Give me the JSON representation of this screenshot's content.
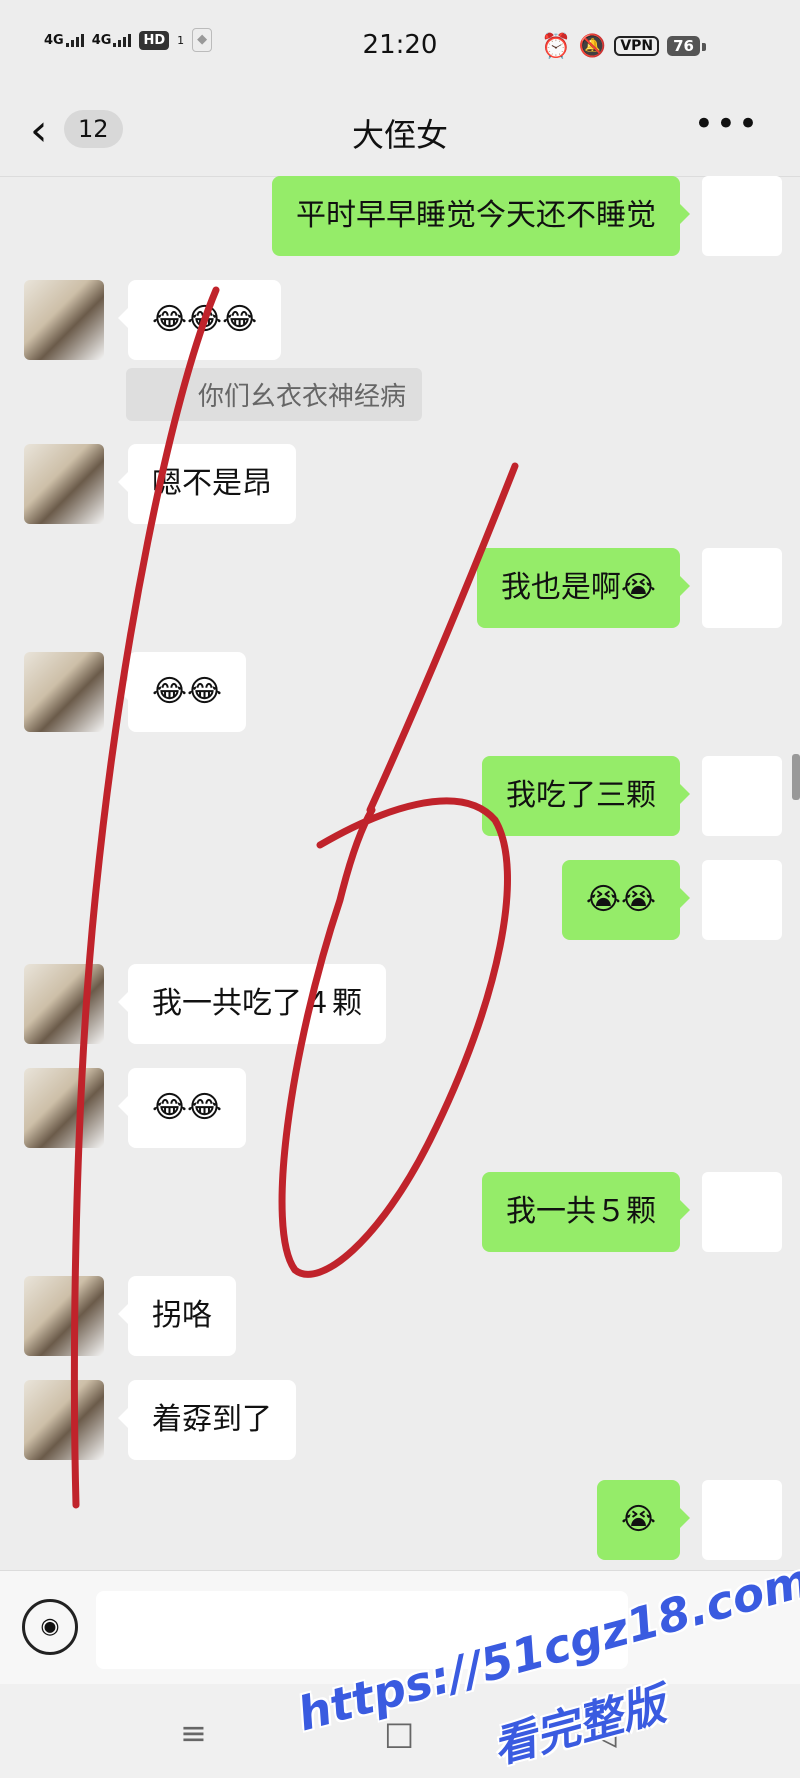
{
  "status": {
    "net1": "4G",
    "net2": "4G",
    "hd": "HD",
    "sim": "1",
    "time": "21:20",
    "vpn": "VPN",
    "battery": "76"
  },
  "header": {
    "back_icon": "chevron-left-icon",
    "unread_count": "12",
    "title": "大侄女",
    "more_icon": "ellipsis-icon"
  },
  "messages": [
    {
      "side": "self",
      "text": "平时早早睡觉今天还不睡觉"
    },
    {
      "side": "other",
      "text": "😂😂😂"
    },
    {
      "side": "other",
      "text": "嗯不是昂"
    },
    {
      "side": "self",
      "text": "我也是啊😭"
    },
    {
      "side": "other",
      "text": "😂😂"
    },
    {
      "side": "self",
      "text": "我吃了三颗"
    },
    {
      "side": "self",
      "text": "😭😭"
    },
    {
      "side": "other",
      "text": "我一共吃了４颗"
    },
    {
      "side": "other",
      "text": "😂😂"
    },
    {
      "side": "self",
      "text": "我一共５颗"
    },
    {
      "side": "other",
      "text": "拐咯"
    },
    {
      "side": "other",
      "text": "着孬到了"
    },
    {
      "side": "self",
      "text": "😭"
    }
  ],
  "quoted_reply": "你们幺衣衣神经病",
  "input": {
    "voice_icon": "voice-icon",
    "placeholder": ""
  },
  "nav": {
    "menu_icon": "≡",
    "home_icon": "□",
    "back_icon": "◁"
  },
  "watermark": {
    "line1": "https://51cgz18.com",
    "line2": "看完整版"
  },
  "colors": {
    "self_bubble": "#95ec69",
    "other_bubble": "#ffffff",
    "background": "#ededed",
    "ink_annotation": "#c0232b",
    "watermark": "#3a5be0"
  }
}
